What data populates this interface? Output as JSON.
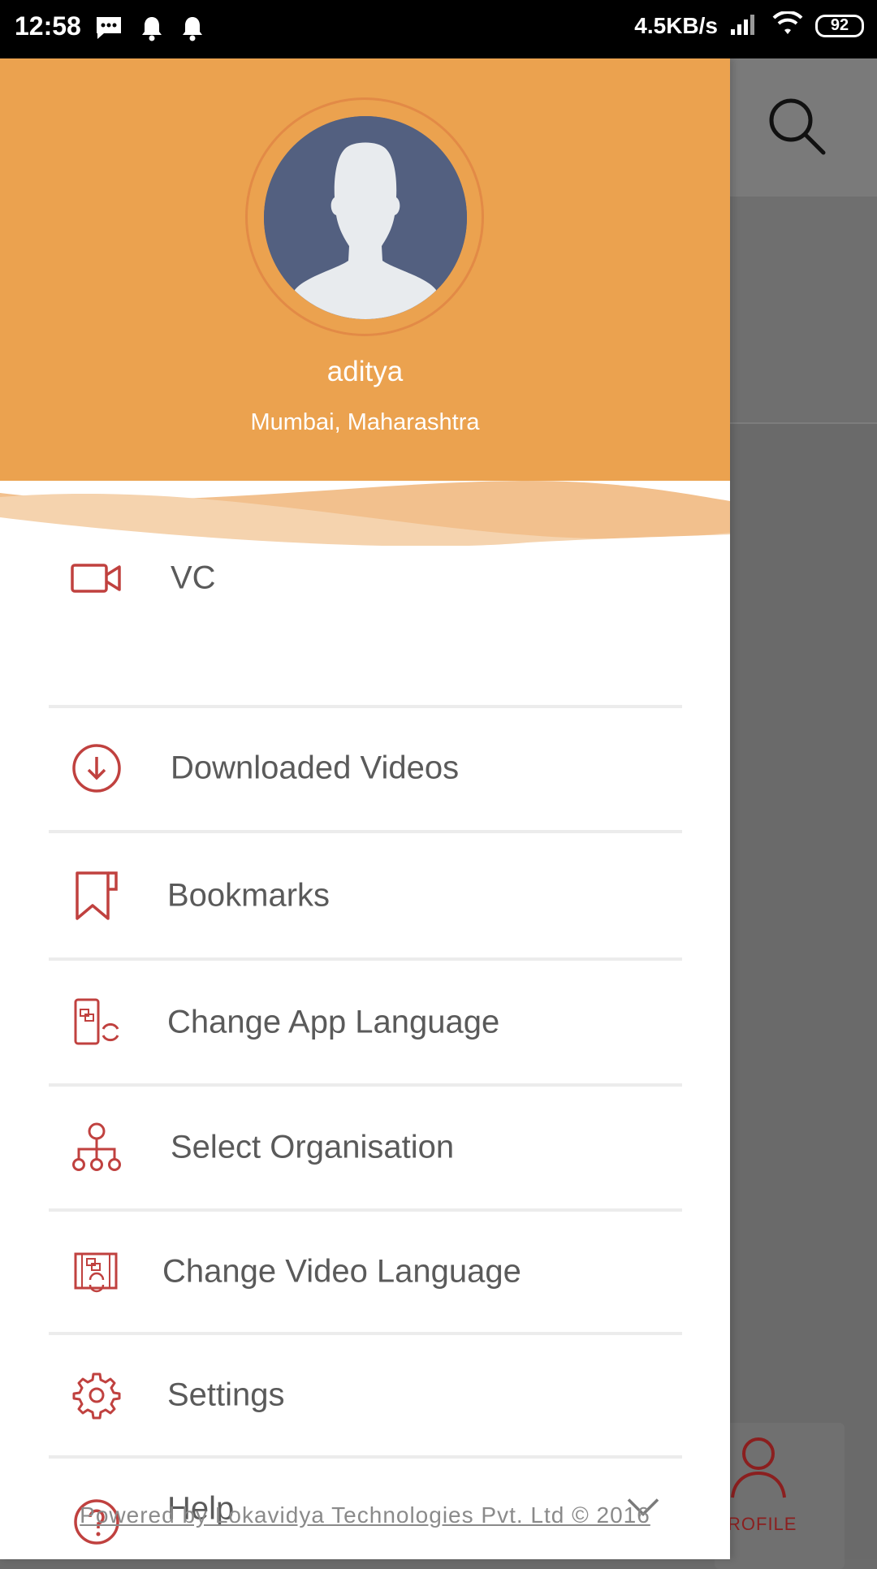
{
  "status_bar": {
    "time": "12:58",
    "network_speed": "4.5KB/s",
    "battery": "92"
  },
  "background_app": {
    "profile_tab_label": "ROFILE"
  },
  "drawer": {
    "user": {
      "name": "aditya",
      "location": "Mumbai, Maharashtra"
    },
    "items": [
      {
        "label": "VC",
        "icon": "video-camera-icon"
      },
      {
        "label": "Downloaded Videos",
        "icon": "download-circle-icon"
      },
      {
        "label": "Bookmarks",
        "icon": "bookmark-icon"
      },
      {
        "label": "Change App Language",
        "icon": "app-language-icon"
      },
      {
        "label": "Select Organisation",
        "icon": "organisation-tree-icon"
      },
      {
        "label": "Change Video Language",
        "icon": "video-language-icon"
      },
      {
        "label": "Settings",
        "icon": "gear-icon"
      },
      {
        "label": "Help",
        "icon": "help-circle-icon"
      }
    ],
    "footer": "Powered by Lokavidya Technologies Pvt. Ltd © 2016"
  },
  "colors": {
    "header_orange": "#eba24f",
    "icon_red": "#c0413f",
    "text_gray": "#5a5a5a"
  }
}
